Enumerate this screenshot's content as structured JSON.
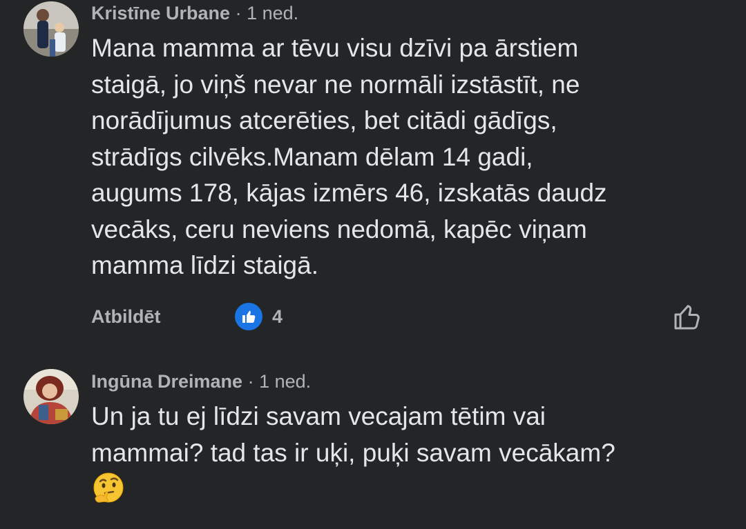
{
  "comments": [
    {
      "author": "Kristīne Urbane",
      "separator": "·",
      "time": "1 ned.",
      "lines": "Mana mamma ar tēvu visu dzīvi pa ārstiem\nstaigā, jo viņš nevar ne normāli izstāstīt, ne\nnorādījumus atcerēties, bet citādi gādīgs,\nstrādīgs cilvēks.Manam dēlam 14 gadi,\naugums 178, kājas izmērs 46, izskatās daudz\nvecāks, ceru neviens nedomā, kapēc viņam\nmamma līdzi staigā.",
      "reply_label": "Atbildēt",
      "reaction_count": "4",
      "reaction_type": "like-icon"
    },
    {
      "author": "Ingūna Dreimane",
      "separator": "·",
      "time": "1 ned.",
      "lines": "Un ja tu ej līdzi savam vecajam tētim vai\nmammai? tad tas ir uķi, puķi savam vecākam?",
      "emoji": "thinking-face-emoji"
    }
  ],
  "colors": {
    "background": "#242526",
    "text_primary": "#e4e6eb",
    "text_secondary": "#b0b3b8",
    "like_blue": "#1b74e4"
  }
}
